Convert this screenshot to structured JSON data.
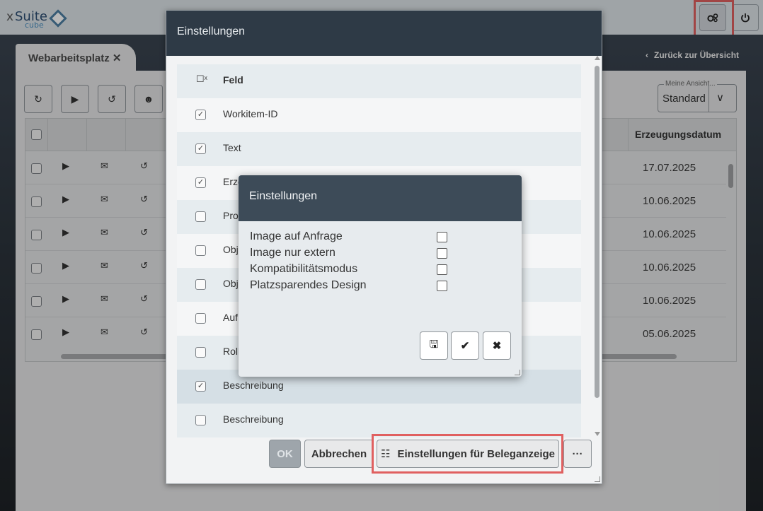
{
  "app": {
    "logo_x": "x",
    "logo_suite": "Suite",
    "logo_cube": "cube",
    "settings_icon": "gears-icon",
    "power_icon": "power-icon"
  },
  "workspace": {
    "tab_label": "Webarbeitsplatz",
    "tab_close": "✕",
    "back_link": "Zurück zur Übersicht",
    "view_label": "Meine Ansicht...",
    "view_value": "Standard"
  },
  "grid": {
    "date_header": "Erzeugungsdatum",
    "rows": [
      {
        "date": "17.07.2025"
      },
      {
        "date": "10.06.2025"
      },
      {
        "date": "10.06.2025"
      },
      {
        "date": "10.06.2025"
      },
      {
        "date": "10.06.2025"
      },
      {
        "date": "05.06.2025"
      }
    ]
  },
  "dialog1": {
    "title": "Einstellungen",
    "header_label": "Feld",
    "fields": [
      {
        "label": "Workitem-ID",
        "checked": true
      },
      {
        "label": "Text",
        "checked": true
      },
      {
        "label": "Erze",
        "checked": true
      },
      {
        "label": "Pro",
        "checked": false
      },
      {
        "label": "Obje",
        "checked": false
      },
      {
        "label": "Obje",
        "checked": false
      },
      {
        "label": "Auf",
        "checked": false
      },
      {
        "label": "Roll",
        "checked": false
      },
      {
        "label": "Beschreibung",
        "checked": true
      },
      {
        "label": "Beschreibung",
        "checked": false
      }
    ],
    "ok_label": "OK",
    "cancel_label": "Abbrechen",
    "doc_settings_label": "Einstellungen für Beleganzeige",
    "more_label": "···"
  },
  "dialog2": {
    "title": "Einstellungen",
    "options": [
      {
        "label": "Image auf Anfrage",
        "checked": false
      },
      {
        "label": "Image nur extern",
        "checked": false
      },
      {
        "label": "Kompatibilitätsmodus",
        "checked": false
      },
      {
        "label": "Platzsparendes Design",
        "checked": false
      }
    ]
  },
  "colors": {
    "highlight": "#e06060",
    "dialog_header": "#2e3a46"
  }
}
